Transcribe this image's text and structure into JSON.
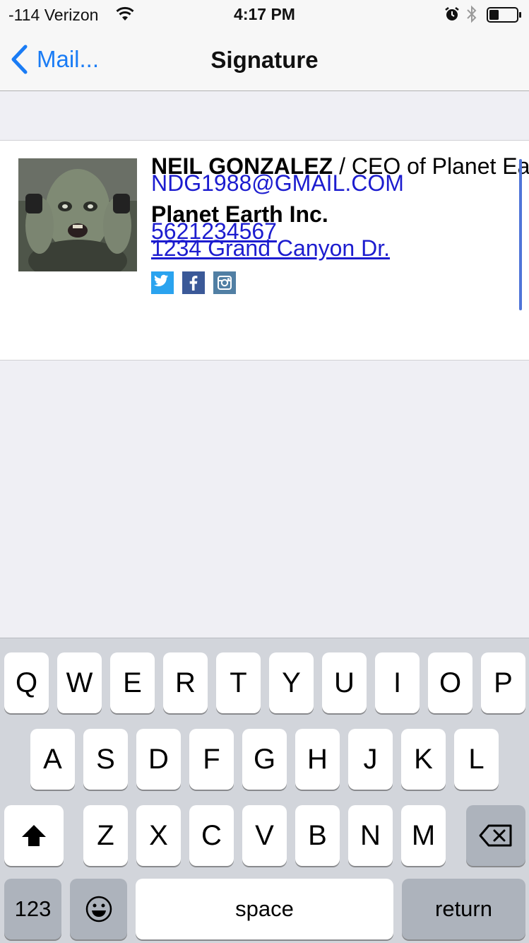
{
  "status_bar": {
    "carrier": "-114 Verizon",
    "time": "4:17 PM",
    "icons": [
      "wifi-icon",
      "alarm-icon",
      "bluetooth-icon",
      "battery-icon"
    ]
  },
  "nav": {
    "back_label": "Mail...",
    "title": "Signature"
  },
  "signature": {
    "name": "NEIL GONZALEZ",
    "title_suffix": " / CEO of Planet Ea",
    "email": "NDG1988@GMAIL.COM",
    "company": "Planet Earth Inc.",
    "phone": "5621234567",
    "address": "1234 Grand Canyon Dr.",
    "social_icons": [
      "twitter-icon",
      "facebook-icon",
      "instagram-icon"
    ],
    "link_color": "#1c1ccf"
  },
  "keyboard": {
    "row1": [
      "Q",
      "W",
      "E",
      "R",
      "T",
      "Y",
      "U",
      "I",
      "O",
      "P"
    ],
    "row2": [
      "A",
      "S",
      "D",
      "F",
      "G",
      "H",
      "J",
      "K",
      "L"
    ],
    "row3": [
      "Z",
      "X",
      "C",
      "V",
      "B",
      "N",
      "M"
    ],
    "numbers_label": "123",
    "space_label": "space",
    "return_label": "return",
    "icons": [
      "shift-icon",
      "delete-icon",
      "emoji-icon"
    ]
  },
  "colors": {
    "accent": "#1a7cf5",
    "keyboard_bg": "#d2d5db",
    "special_key": "#adb3bc"
  }
}
